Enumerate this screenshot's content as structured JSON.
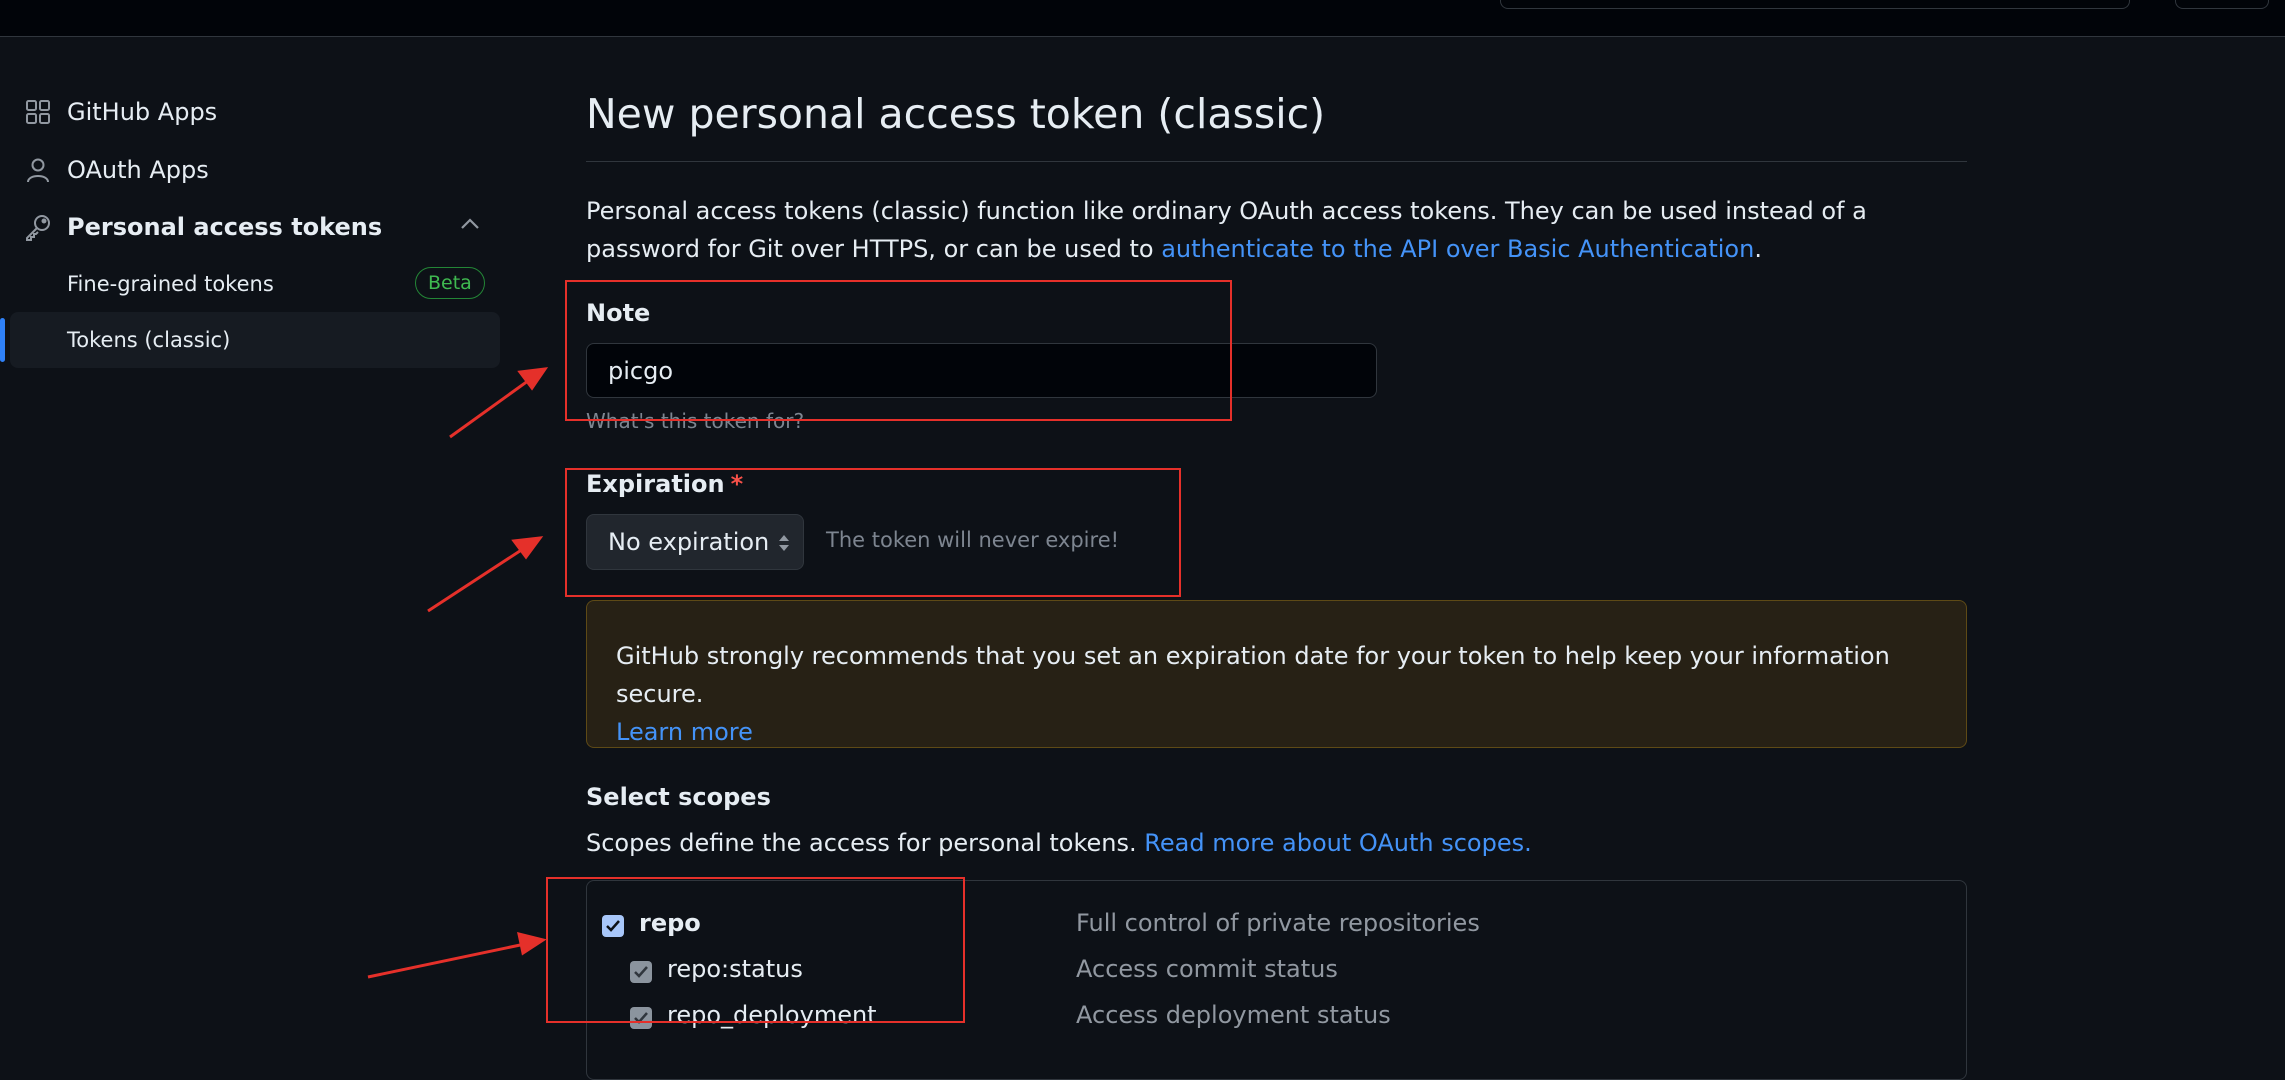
{
  "sidebar": {
    "items": [
      {
        "label": "GitHub Apps",
        "icon": "apps-grid-icon"
      },
      {
        "label": "OAuth Apps",
        "icon": "person-icon"
      },
      {
        "label": "Personal access tokens",
        "icon": "key-icon"
      }
    ],
    "sub_items": [
      {
        "label": "Fine-grained tokens",
        "badge": "Beta"
      },
      {
        "label": "Tokens (classic)",
        "active": true
      }
    ]
  },
  "main": {
    "title": "New personal access token (classic)",
    "description_prefix": "Personal access tokens (classic) function like ordinary OAuth access tokens. They can be used instead of a password for Git over HTTPS, or can be used to ",
    "description_link": "authenticate to the API over Basic Authentication",
    "description_suffix": ".",
    "note": {
      "label": "Note",
      "value": "picgo",
      "hint": "What's this token for?"
    },
    "expiration": {
      "label": "Expiration",
      "required_mark": "*",
      "selected": "No expiration",
      "note": "The token will never expire!"
    },
    "warning": {
      "text": "GitHub strongly recommends that you set an expiration date for your token to help keep your information secure.",
      "link": "Learn more"
    },
    "scopes": {
      "title": "Select scopes",
      "desc_prefix": "Scopes define the access for personal tokens. ",
      "desc_link": "Read more about OAuth scopes.",
      "rows": [
        {
          "name": "repo",
          "desc": "Full control of private repositories",
          "checked": true,
          "level": 0
        },
        {
          "name": "repo:status",
          "desc": "Access commit status",
          "checked": true,
          "level": 1
        },
        {
          "name": "repo_deployment",
          "desc": "Access deployment status",
          "checked": true,
          "level": 1
        }
      ]
    }
  },
  "colors": {
    "background": "#0d1117",
    "link": "#4493f8",
    "annotation": "#e5302a",
    "beta": "#3fb950"
  }
}
